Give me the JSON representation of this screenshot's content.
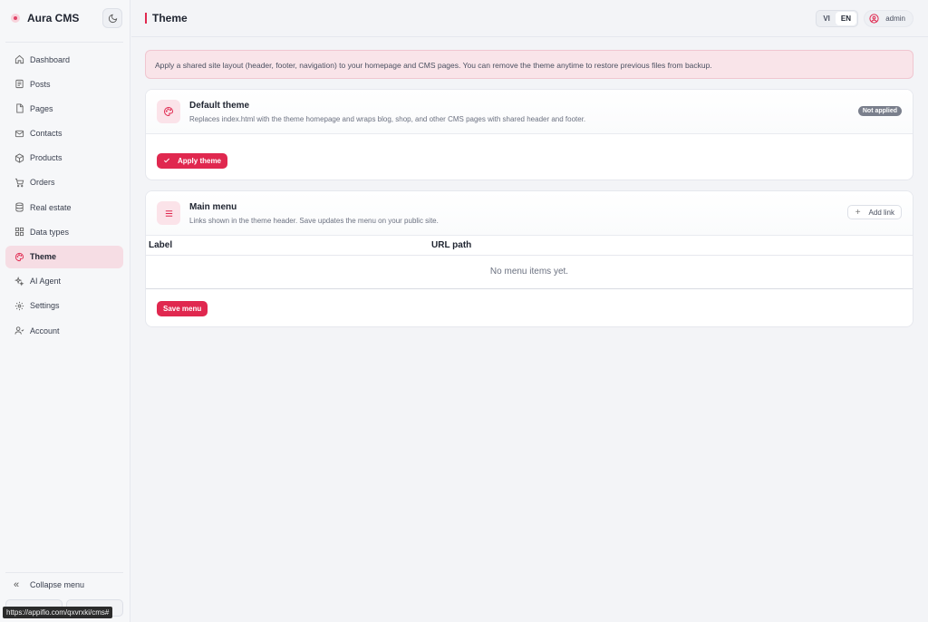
{
  "app": {
    "name": "Aura CMS",
    "accent_color": "#e0284f"
  },
  "sidebar": {
    "items": [
      {
        "label": "Dashboard",
        "icon": "home-icon"
      },
      {
        "label": "Posts",
        "icon": "document-icon"
      },
      {
        "label": "Pages",
        "icon": "page-icon"
      },
      {
        "label": "Contacts",
        "icon": "mail-icon"
      },
      {
        "label": "Products",
        "icon": "box-icon"
      },
      {
        "label": "Orders",
        "icon": "cart-icon"
      },
      {
        "label": "Real estate",
        "icon": "database-icon"
      },
      {
        "label": "Data types",
        "icon": "grid-icon"
      },
      {
        "label": "Theme",
        "icon": "palette-icon",
        "active": true
      },
      {
        "label": "AI Agent",
        "icon": "sparkles-icon"
      },
      {
        "label": "Settings",
        "icon": "gear-icon"
      },
      {
        "label": "Account",
        "icon": "user-icon"
      }
    ],
    "collapse_label": "Collapse menu"
  },
  "status_url": "https://appifio.com/qxvrxki/cms#",
  "header": {
    "title": "Theme",
    "lang_options": [
      "VI",
      "EN"
    ],
    "lang_selected": "EN",
    "user": "admin"
  },
  "notice": "Apply a shared site layout (header, footer, navigation) to your homepage and CMS pages. You can remove the theme anytime to restore previous files from backup.",
  "default_theme": {
    "title": "Default theme",
    "description": "Replaces index.html with the theme homepage and wraps blog, shop, and other CMS pages with shared header and footer.",
    "status": "Not applied",
    "apply_label": "Apply theme"
  },
  "main_menu": {
    "title": "Main menu",
    "description": "Links shown in the theme header. Save updates the menu on your public site.",
    "add_label": "Add link",
    "columns": [
      "Label",
      "URL path"
    ],
    "empty_text": "No menu items yet.",
    "save_label": "Save menu"
  }
}
